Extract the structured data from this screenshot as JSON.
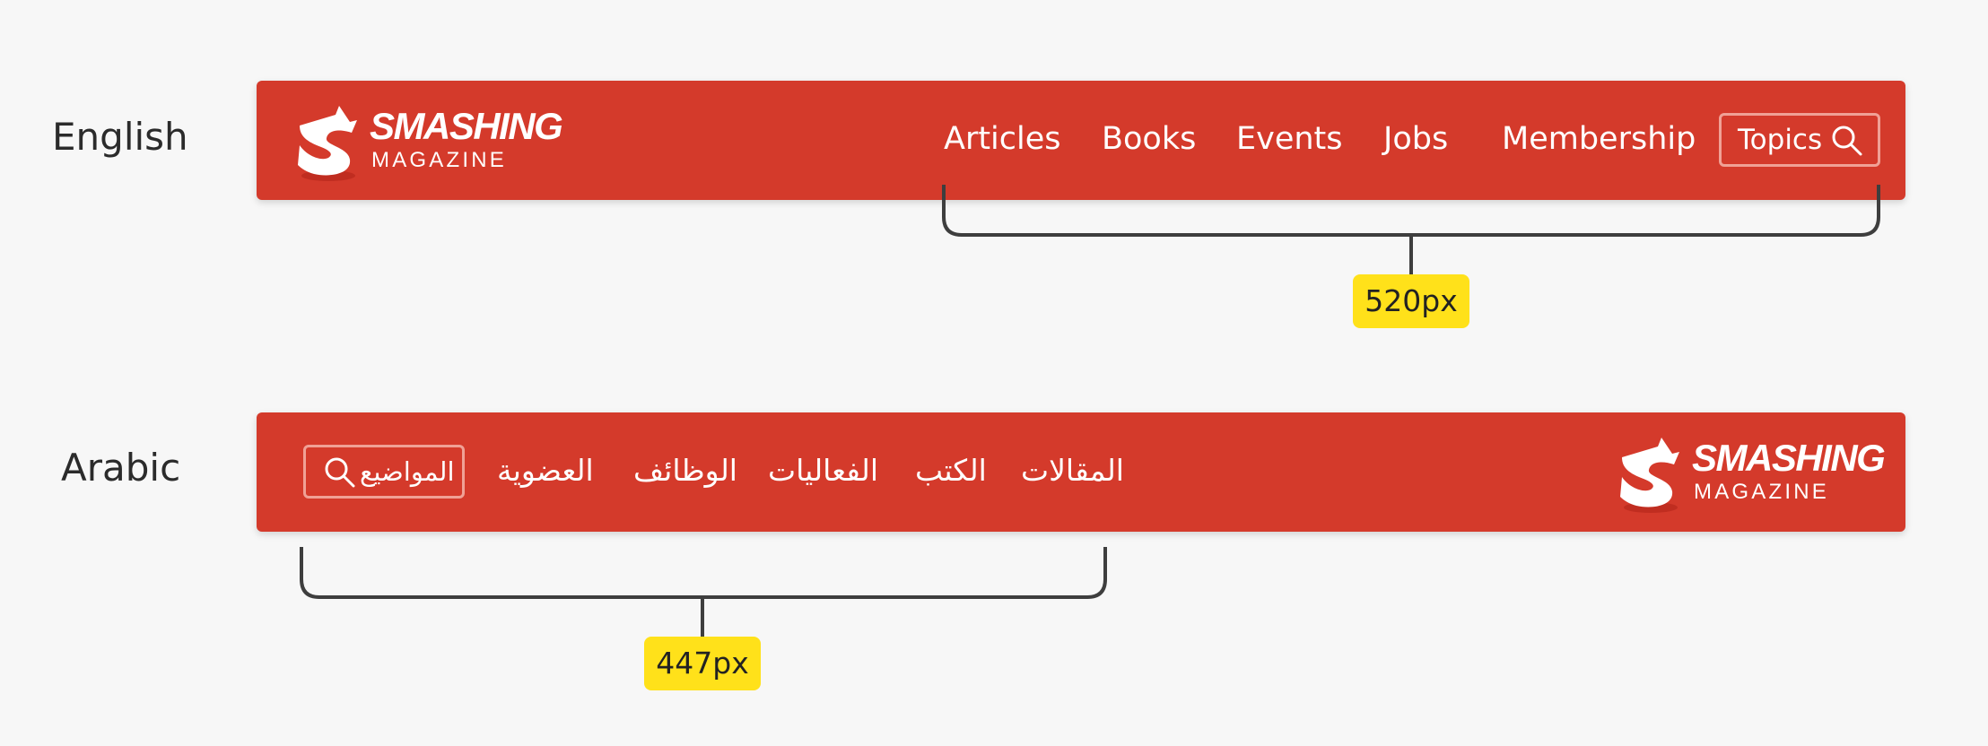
{
  "colors": {
    "background": "#f7f7f7",
    "navbar": "#d43a2b",
    "button_border": "#f0a196",
    "bracket": "#3e3e3e",
    "badge": "#ffe11a"
  },
  "english": {
    "label": "English",
    "logo": {
      "main": "SMASHING",
      "sub": "MAGAZINE",
      "icon": "smashing-s-logo-icon"
    },
    "nav": [
      "Articles",
      "Books",
      "Events",
      "Jobs",
      "Membership"
    ],
    "topics": {
      "label": "Topics",
      "icon": "search-icon"
    },
    "measure": "520px"
  },
  "arabic": {
    "label": "Arabic",
    "logo": {
      "main": "SMASHING",
      "sub": "MAGAZINE",
      "icon": "smashing-s-logo-icon"
    },
    "nav": [
      "المقالات",
      "الكتب",
      "الفعاليات",
      "الوظائف",
      "العضوية"
    ],
    "topics": {
      "label": "المواضيع",
      "icon": "search-icon"
    },
    "measure": "447px"
  }
}
